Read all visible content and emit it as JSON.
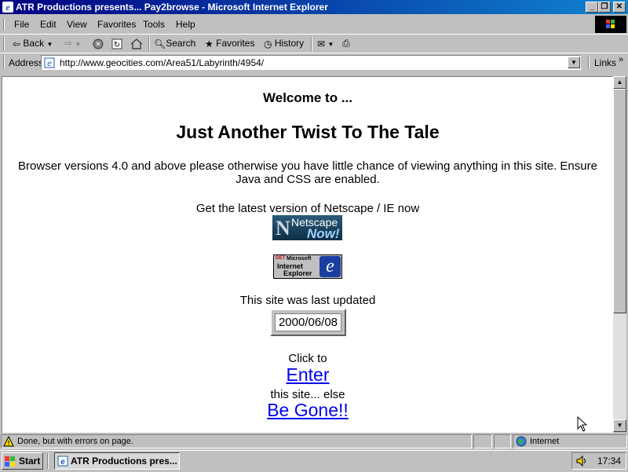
{
  "window": {
    "title": "ATR Productions presents... Pay2browse - Microsoft Internet Explorer",
    "buttons": {
      "minimize": "_",
      "maximize": "❐",
      "close": "✕"
    }
  },
  "menu": [
    "File",
    "Edit",
    "View",
    "Favorites",
    "Tools",
    "Help"
  ],
  "toolbar": {
    "back": "Back",
    "search": "Search",
    "favorites": "Favorites",
    "history": "History"
  },
  "address": {
    "label": "Address",
    "url": "http://www.geocities.com/Area51/Labyrinth/4954/",
    "links": "Links"
  },
  "page": {
    "welcome": "Welcome to ...",
    "heading": "Just Another Twist To The Tale",
    "browser_note_1": "Browser versions 4.0 and above please otherwise you have little chance of viewing anything in this site. Ensure",
    "browser_note_2": "Java and CSS are enabled.",
    "get_latest": "Get the latest version of Netscape / IE now",
    "netscape_badge_top": "Netscape",
    "netscape_badge_bottom": "Now!",
    "ie_badge_get": "GET",
    "ie_badge_ms": "Microsoft",
    "ie_badge_ie": "Internet",
    "ie_badge_ex": "Explorer",
    "updated_label": "This site was last updated",
    "updated_date": "2000/06/08",
    "click_to": "Click to",
    "enter_link": "Enter",
    "else_text": "this site... else",
    "begone_link": "Be Gone!!"
  },
  "status": {
    "message": "Done, but with errors on page.",
    "zone": "Internet"
  },
  "taskbar": {
    "start": "Start",
    "task": "ATR Productions pres...",
    "clock": "17:34"
  },
  "colors": {
    "link": "#0000ee",
    "title_start": "#000080",
    "title_end": "#1084d0"
  }
}
